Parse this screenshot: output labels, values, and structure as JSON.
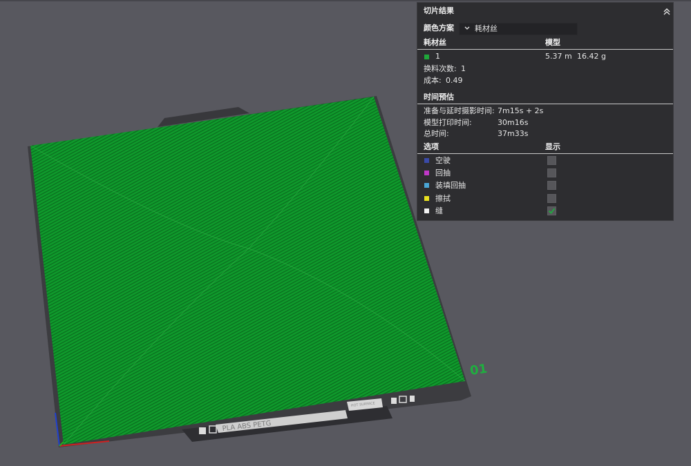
{
  "panel": {
    "title": "切片结果",
    "color_scheme_label": "颜色方案",
    "color_scheme_value": "耗材丝",
    "filament_header": "耗材丝",
    "model_header": "模型",
    "filament": {
      "index": "1",
      "color": "#1fa83a",
      "length": "5.37 m",
      "weight": "16.42 g"
    },
    "change_count_label": "换料次数:",
    "change_count_value": "1",
    "cost_label": "成本:",
    "cost_value": "0.49",
    "time_header": "时间预估",
    "prep_label": "准备与延时摄影时间:",
    "prep_value": "7m15s + 2s",
    "model_time_label": "模型打印时间:",
    "model_time_value": "30m16s",
    "total_label": "总时间:",
    "total_value": "37m33s",
    "options_header": "选项",
    "display_header": "显示",
    "options": [
      {
        "label": "空驶",
        "color": "#3a4aa8",
        "checked": false
      },
      {
        "label": "回抽",
        "color": "#c038c8",
        "checked": false
      },
      {
        "label": "装填回抽",
        "color": "#4aa6d6",
        "checked": false
      },
      {
        "label": "擦拭",
        "color": "#e8e020",
        "checked": false
      },
      {
        "label": "缝",
        "color": "#f2f2f2",
        "checked": true
      }
    ]
  },
  "plate": {
    "number": "01",
    "bed_text": "PLA ABS PETG",
    "bed_tag": "HOT SURFACE",
    "print_color": "#0e9a2c"
  }
}
